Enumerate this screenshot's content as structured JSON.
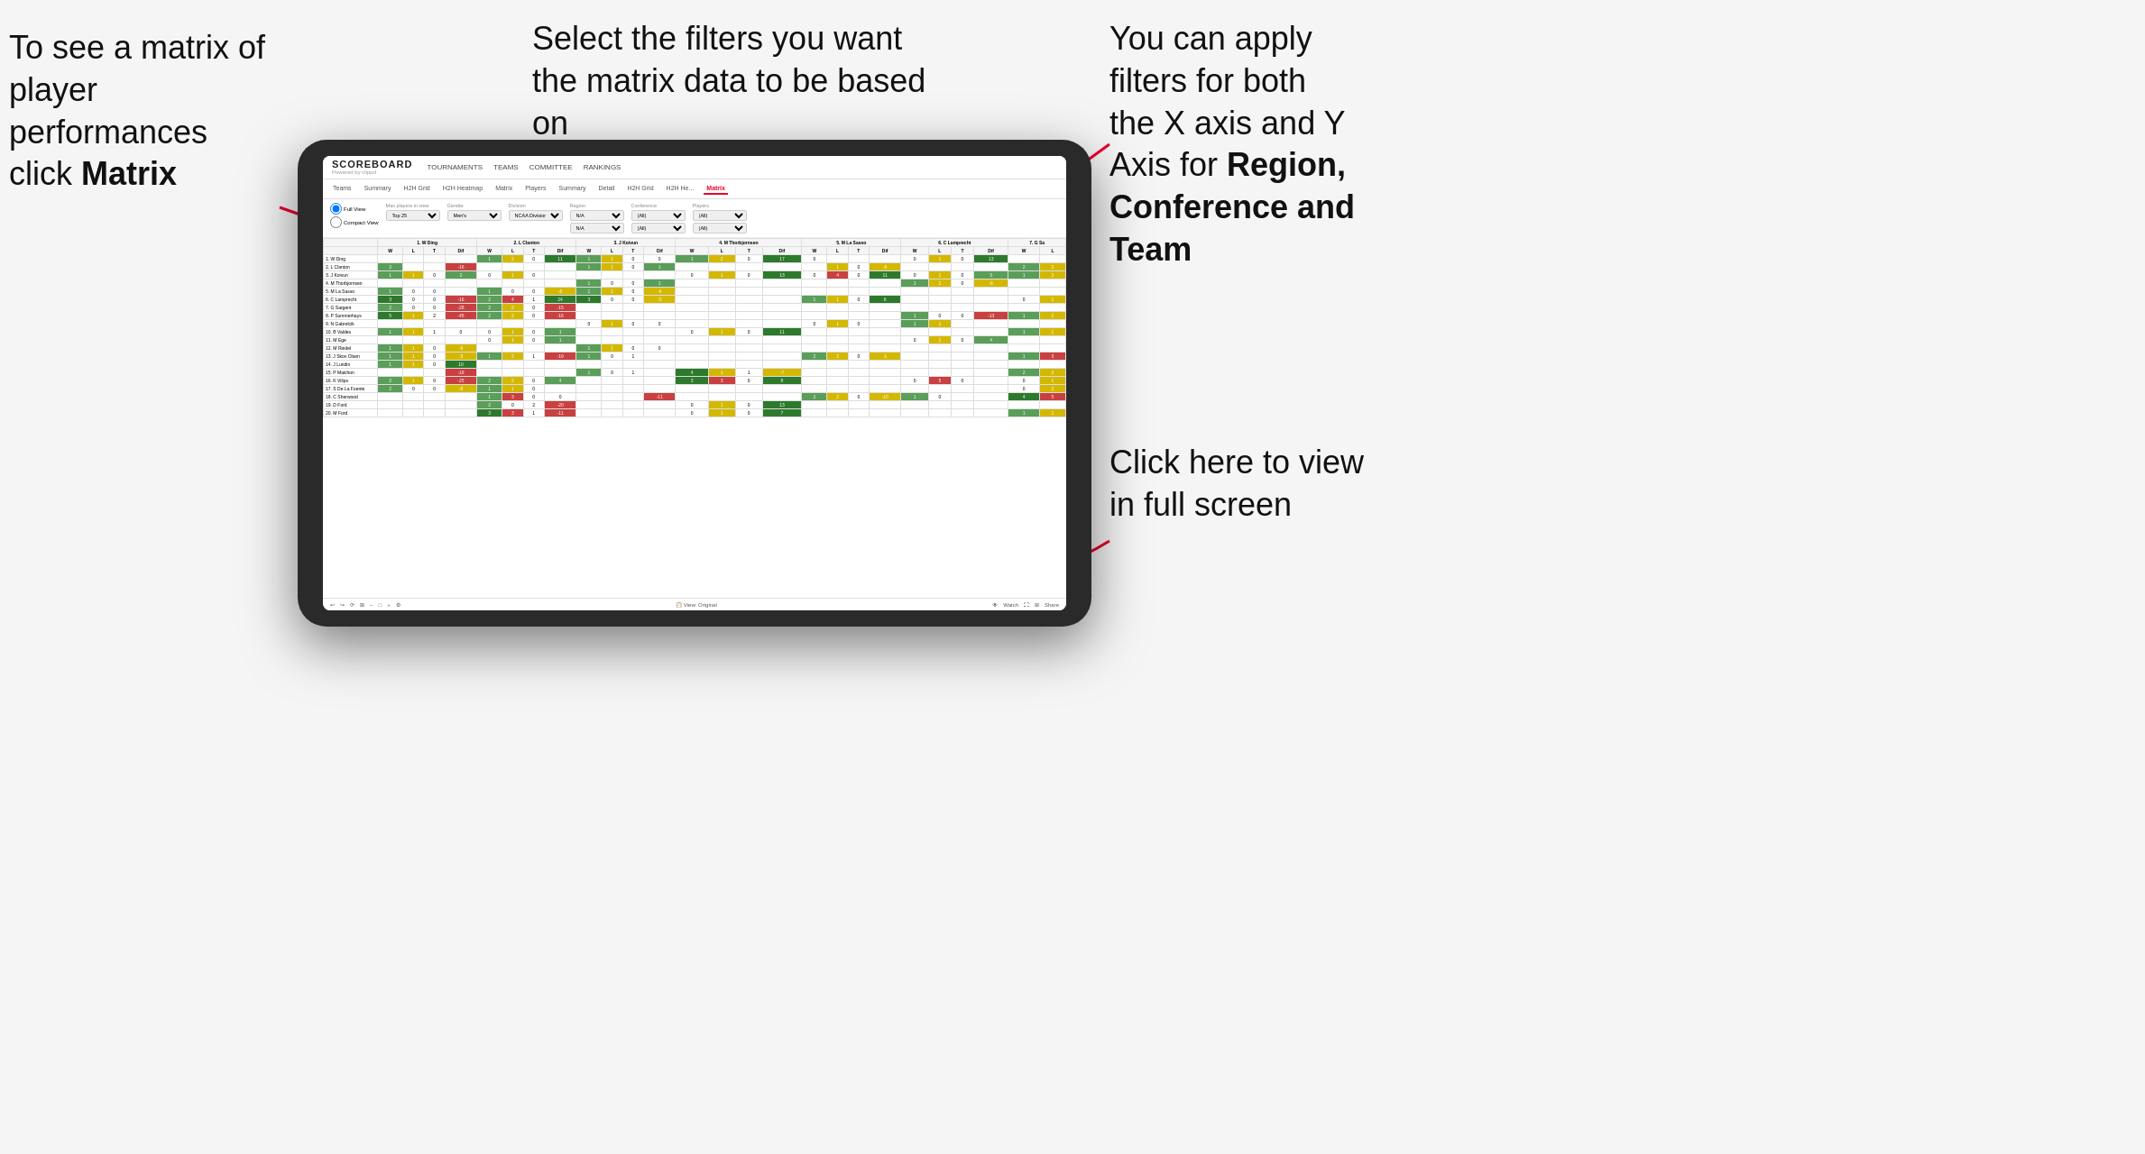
{
  "annotations": {
    "topleft": {
      "line1": "To see a matrix of",
      "line2": "player performances",
      "line3_normal": "click ",
      "line3_bold": "Matrix"
    },
    "topmid": {
      "text": "Select the filters you want the matrix data to be based on"
    },
    "topright": {
      "line1": "You  can apply",
      "line2": "filters for both",
      "line3": "the X axis and Y",
      "line4_normal": "Axis for ",
      "line4_bold": "Region,",
      "line5_bold": "Conference and",
      "line6_bold": "Team"
    },
    "bottomright": {
      "line1": "Click here to view",
      "line2": "in full screen"
    }
  },
  "nav": {
    "logo_title": "SCOREBOARD",
    "logo_subtitle": "Powered by clippd",
    "items": [
      "TOURNAMENTS",
      "TEAMS",
      "COMMITTEE",
      "RANKINGS"
    ]
  },
  "tabs": {
    "items": [
      "Teams",
      "Summary",
      "H2H Grid",
      "H2H Heatmap",
      "Matrix",
      "Players",
      "Summary",
      "Detail",
      "H2H Grid",
      "H2H He...",
      "Matrix"
    ]
  },
  "filters": {
    "view_full": "Full View",
    "view_compact": "Compact View",
    "max_players_label": "Max players in view",
    "max_players_value": "Top 25",
    "gender_label": "Gender",
    "gender_value": "Men's",
    "division_label": "Division",
    "division_value": "NCAA Division I",
    "region_label": "Region",
    "region_value": "N/A",
    "conference_label": "Conference",
    "conference_values": [
      "(All)",
      "(All)"
    ],
    "players_label": "Players",
    "players_values": [
      "(All)",
      "(All)"
    ]
  },
  "matrix": {
    "col_headers": [
      "1. W Ding",
      "2. L Clanton",
      "3. J Koivun",
      "4. M Thorbjornsen",
      "5. M La Sasso",
      "6. C Lamprecht",
      "7. G Sa"
    ],
    "sub_headers": [
      "W",
      "L",
      "T",
      "Dif"
    ],
    "rows": [
      {
        "name": "1. W Ding",
        "data": [
          [
            null,
            null,
            null,
            null
          ],
          [
            1,
            2,
            0,
            11
          ],
          [
            1,
            1,
            0,
            0
          ],
          [
            1,
            2,
            0,
            17
          ],
          [
            0,
            null,
            null,
            null
          ],
          [
            0,
            1,
            0,
            13
          ],
          [
            null,
            null
          ]
        ]
      },
      {
        "name": "2. L Clanton",
        "data": [
          [
            2,
            null,
            null,
            -16
          ],
          [
            null,
            null,
            null,
            null
          ],
          [
            1,
            1,
            0,
            1
          ],
          [
            null,
            null,
            null,
            null
          ],
          [
            null,
            1,
            0,
            -6
          ],
          [
            null,
            null,
            null,
            null
          ],
          [
            2,
            2
          ]
        ]
      },
      {
        "name": "3. J Koivun",
        "data": [
          [
            1,
            1,
            0,
            2
          ],
          [
            0,
            1,
            0,
            null
          ],
          [
            null,
            null,
            null,
            null
          ],
          [
            0,
            1,
            0,
            13
          ],
          [
            0,
            4,
            0,
            11
          ],
          [
            0,
            1,
            0,
            3
          ],
          [
            1,
            2
          ]
        ]
      },
      {
        "name": "4. M Thorbjornsen",
        "data": [
          [
            null,
            null,
            null,
            null
          ],
          [
            null,
            null,
            null,
            null
          ],
          [
            1,
            0,
            0,
            1
          ],
          [
            null,
            null,
            null,
            null
          ],
          [
            null,
            null,
            null,
            null
          ],
          [
            1,
            1,
            0,
            -6
          ],
          [
            null,
            null
          ]
        ]
      },
      {
        "name": "5. M La Sasso",
        "data": [
          [
            1,
            0,
            0,
            null
          ],
          [
            1,
            0,
            0,
            -6
          ],
          [
            1,
            1,
            0,
            -6
          ],
          [
            null,
            null,
            null,
            null
          ],
          [
            null,
            null,
            null,
            null
          ],
          [
            null,
            null,
            null,
            null
          ],
          [
            null,
            null
          ]
        ]
      },
      {
        "name": "6. C Lamprecht",
        "data": [
          [
            3,
            0,
            0,
            -16
          ],
          [
            2,
            4,
            1,
            24
          ],
          [
            3,
            0,
            0,
            -5
          ],
          [
            null,
            null,
            null,
            null
          ],
          [
            1,
            1,
            0,
            6
          ],
          [
            null,
            null,
            null,
            null
          ],
          [
            0,
            1
          ]
        ]
      },
      {
        "name": "7. G Sargent",
        "data": [
          [
            2,
            0,
            0,
            -28
          ],
          [
            2,
            2,
            0,
            -15
          ],
          [
            null,
            null,
            null,
            null
          ],
          [
            null,
            null,
            null,
            null
          ],
          [
            null,
            null,
            null,
            null
          ],
          [
            null,
            null,
            null,
            null
          ],
          [
            null,
            null
          ]
        ]
      },
      {
        "name": "8. P Summerhays",
        "data": [
          [
            5,
            1,
            2,
            -45
          ],
          [
            2,
            2,
            0,
            -16
          ],
          [
            null,
            null,
            null,
            null
          ],
          [
            null,
            null,
            null,
            null
          ],
          [
            null,
            null,
            null,
            null
          ],
          [
            1,
            0,
            0,
            -13
          ],
          [
            1,
            2
          ]
        ]
      },
      {
        "name": "9. N Gabrelcik",
        "data": [
          [
            null,
            null,
            null,
            null
          ],
          [
            null,
            null,
            null,
            null
          ],
          [
            0,
            1,
            0,
            0
          ],
          [
            null,
            null,
            null,
            null
          ],
          [
            0,
            1,
            0,
            null
          ],
          [
            1,
            1,
            null,
            null
          ],
          [
            null,
            null
          ]
        ]
      },
      {
        "name": "10. B Valdes",
        "data": [
          [
            1,
            1,
            1,
            0
          ],
          [
            0,
            1,
            0,
            1
          ],
          [
            null,
            null,
            null,
            null
          ],
          [
            0,
            1,
            0,
            11
          ],
          [
            null,
            null,
            null,
            null
          ],
          [
            null,
            null,
            null,
            null
          ],
          [
            1,
            1
          ]
        ]
      },
      {
        "name": "11. M Ege",
        "data": [
          [
            null,
            null,
            null,
            null
          ],
          [
            0,
            1,
            0,
            1
          ],
          [
            null,
            null,
            null,
            null
          ],
          [
            null,
            null,
            null,
            null
          ],
          [
            null,
            null,
            null,
            null
          ],
          [
            0,
            1,
            0,
            4
          ],
          [
            null,
            null
          ]
        ]
      },
      {
        "name": "12. M Riedel",
        "data": [
          [
            1,
            1,
            0,
            -6
          ],
          [
            null,
            null,
            null,
            null
          ],
          [
            1,
            1,
            0,
            0
          ],
          [
            null,
            null,
            null,
            null
          ],
          [
            null,
            null,
            null,
            null
          ],
          [
            null,
            null,
            null,
            null
          ],
          [
            null,
            null
          ]
        ]
      },
      {
        "name": "13. J Skov Olsen",
        "data": [
          [
            1,
            1,
            0,
            -3
          ],
          [
            1,
            2,
            1,
            -19
          ],
          [
            1,
            0,
            1,
            null
          ],
          [
            null,
            null,
            null,
            null
          ],
          [
            2,
            2,
            0,
            -1
          ],
          [
            null,
            null,
            null,
            null
          ],
          [
            1,
            3
          ]
        ]
      },
      {
        "name": "14. J Lundin",
        "data": [
          [
            1,
            1,
            0,
            10
          ],
          [
            null,
            null,
            null,
            null
          ],
          [
            null,
            null,
            null,
            null
          ],
          [
            null,
            null,
            null,
            null
          ],
          [
            null,
            null,
            null,
            null
          ],
          [
            null,
            null,
            null,
            null
          ],
          [
            null,
            null
          ]
        ]
      },
      {
        "name": "15. P Maichon",
        "data": [
          [
            null,
            null,
            null,
            -19
          ],
          [
            null,
            null,
            null,
            null
          ],
          [
            1,
            0,
            1,
            null
          ],
          [
            4,
            1,
            1,
            -7
          ],
          [
            null,
            null,
            null,
            null
          ],
          [
            null,
            null,
            null,
            null
          ],
          [
            2,
            2
          ]
        ]
      },
      {
        "name": "16. K Vilips",
        "data": [
          [
            2,
            1,
            0,
            -25
          ],
          [
            2,
            2,
            0,
            4
          ],
          [
            null,
            null,
            null,
            null
          ],
          [
            3,
            3,
            0,
            8
          ],
          [
            null,
            null,
            null,
            null
          ],
          [
            0,
            5,
            0,
            null
          ],
          [
            0,
            1
          ]
        ]
      },
      {
        "name": "17. S De La Fuente",
        "data": [
          [
            2,
            0,
            0,
            -8
          ],
          [
            1,
            1,
            0,
            null
          ],
          [
            null,
            null,
            null,
            null
          ],
          [
            null,
            null,
            null,
            null
          ],
          [
            null,
            null,
            null,
            null
          ],
          [
            null,
            null,
            null,
            null
          ],
          [
            0,
            2
          ]
        ]
      },
      {
        "name": "18. C Sherwood",
        "data": [
          [
            null,
            null,
            null,
            null
          ],
          [
            1,
            3,
            0,
            0
          ],
          [
            null,
            null,
            null,
            -11
          ],
          [
            null,
            null,
            null,
            null
          ],
          [
            2,
            2,
            0,
            -10
          ],
          [
            1,
            0,
            null,
            null
          ],
          [
            4,
            5
          ]
        ]
      },
      {
        "name": "19. D Ford",
        "data": [
          [
            null,
            null,
            null,
            null
          ],
          [
            2,
            0,
            2,
            -20
          ],
          [
            null,
            null,
            null,
            null
          ],
          [
            0,
            1,
            0,
            13
          ],
          [
            null,
            null,
            null,
            null
          ],
          [
            null,
            null,
            null,
            null
          ],
          [
            null,
            null
          ]
        ]
      },
      {
        "name": "20. M Ford",
        "data": [
          [
            null,
            null,
            null,
            null
          ],
          [
            3,
            3,
            1,
            -11
          ],
          [
            null,
            null,
            null,
            null
          ],
          [
            0,
            1,
            0,
            7
          ],
          [
            null,
            null,
            null,
            null
          ],
          [
            null,
            null,
            null,
            null
          ],
          [
            1,
            1
          ]
        ]
      }
    ]
  },
  "toolbar": {
    "view_label": "View: Original",
    "watch_label": "Watch",
    "share_label": "Share"
  }
}
